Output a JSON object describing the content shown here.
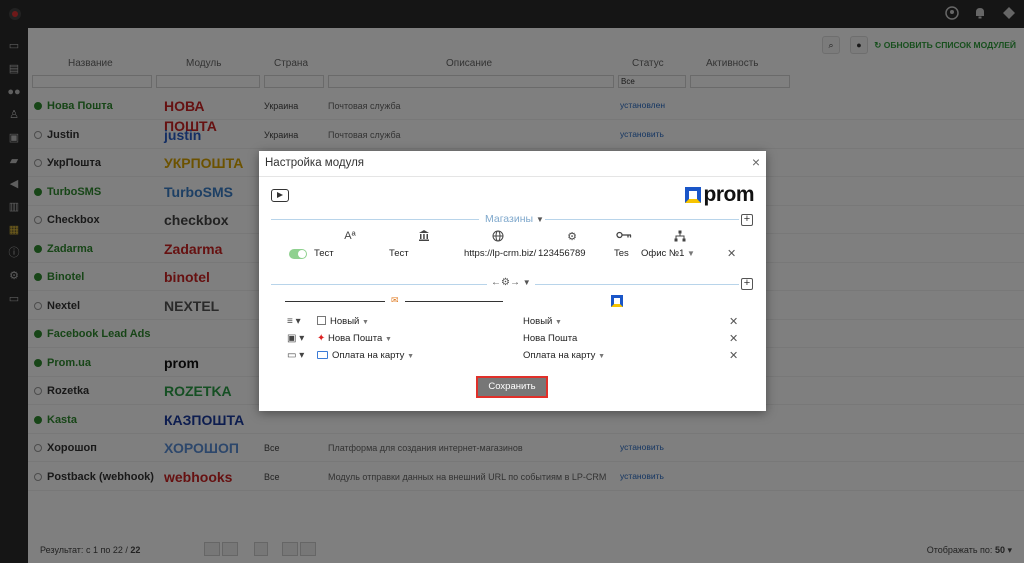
{
  "sidebar": {
    "icons": [
      "monitor-icon",
      "chart-icon",
      "users-icon",
      "user-icon",
      "box-icon",
      "chat-icon",
      "megaphone-icon",
      "bar-chart-icon",
      "modules-icon",
      "info-icon",
      "settings-icon",
      "wallet-icon"
    ]
  },
  "topbar": {
    "icons": [
      "help-icon",
      "bell-icon",
      "user-menu-icon"
    ]
  },
  "toolbar": {
    "refresh_label": "ОБНОВИТЬ СПИСОК МОДУЛЕЙ"
  },
  "table": {
    "headers": {
      "name": "Название",
      "module": "Модуль",
      "country": "Страна",
      "description": "Описание",
      "status": "Статус",
      "activity": "Активность"
    },
    "status_filter": "Все",
    "rows": [
      {
        "name": "Нова Пошта",
        "active": true,
        "logo": "НОВА ПОШТА",
        "country": "Украина",
        "desc": "Почтовая служба",
        "status": "установлен"
      },
      {
        "name": "Justin",
        "active": false,
        "logo": "justin",
        "country": "Украина",
        "desc": "Почтовая служба",
        "status": "установить"
      },
      {
        "name": "УкрПошта",
        "active": false,
        "logo": "УКРПОШТА",
        "country": "",
        "desc": "",
        "status": ""
      },
      {
        "name": "TurboSMS",
        "active": true,
        "logo": "TurboSMS",
        "country": "",
        "desc": "",
        "status": ""
      },
      {
        "name": "Checkbox",
        "active": false,
        "logo": "checkbox",
        "country": "",
        "desc": "",
        "status": ""
      },
      {
        "name": "Zadarma",
        "active": true,
        "logo": "Zadarma",
        "country": "",
        "desc": "",
        "status": ""
      },
      {
        "name": "Binotel",
        "active": true,
        "logo": "binotel",
        "country": "",
        "desc": "",
        "status": ""
      },
      {
        "name": "Nextel",
        "active": false,
        "logo": "NEXTEL",
        "country": "",
        "desc": "",
        "status": ""
      },
      {
        "name": "Facebook Lead Ads",
        "active": true,
        "logo": "",
        "country": "",
        "desc": "",
        "status": ""
      },
      {
        "name": "Prom.ua",
        "active": true,
        "logo": "prom",
        "country": "",
        "desc": "",
        "status": ""
      },
      {
        "name": "Rozetka",
        "active": false,
        "logo": "ROZETKA",
        "country": "",
        "desc": "",
        "status": ""
      },
      {
        "name": "Kasta",
        "active": true,
        "logo": "КАЗПОШТА",
        "country": "",
        "desc": "",
        "status": ""
      },
      {
        "name": "Хорошоп",
        "active": false,
        "logo": "ХОРОШОП",
        "country": "Все",
        "desc": "Платформа для создания интернет-магазинов",
        "status": "установить"
      },
      {
        "name": "Postback (webhook)",
        "active": false,
        "logo": "webhooks",
        "country": "Все",
        "desc": "Модуль отправки данных на внешний URL по событиям в LP-CRM",
        "status": "установить"
      }
    ]
  },
  "footer": {
    "results_label": "Результат:",
    "results_value": "с 1 по 22 /",
    "results_total": "22",
    "per_page_label": "Отображать по:",
    "per_page_value": "50"
  },
  "modal": {
    "title": "Настройка модуля",
    "close": "×",
    "logo_text": "prom",
    "shops_section": "Магазины",
    "shop": {
      "name": "Тест",
      "title": "Тест",
      "url": "https://lp-crm.biz/",
      "id": "123456789",
      "key": "Tes",
      "office": "Офис №1"
    },
    "mappings": [
      {
        "left": "Новый",
        "right": "Новый"
      },
      {
        "left": "Нова Пошта",
        "right": "Нова Пошта"
      },
      {
        "left": "Оплата на карту",
        "right": "Оплата на карту"
      }
    ],
    "save_label": "Сохранить"
  }
}
